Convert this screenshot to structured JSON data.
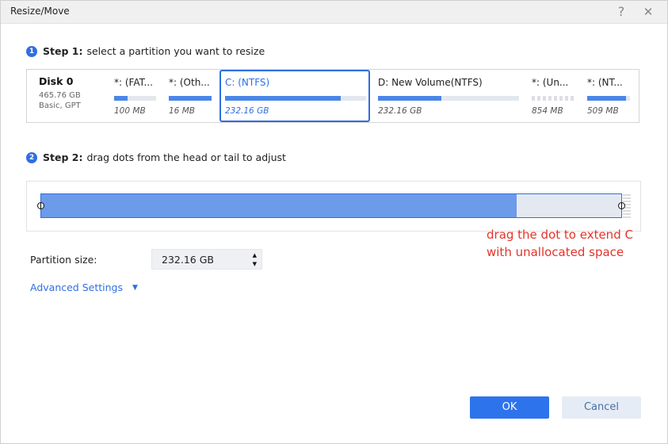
{
  "window": {
    "title": "Resize/Move",
    "help_glyph": "?",
    "close_glyph": "✕"
  },
  "step1": {
    "num": "1",
    "bold": "Step 1:",
    "text": "select a partition you want to resize"
  },
  "step2": {
    "num": "2",
    "bold": "Step 2:",
    "text": "drag dots from the head or tail to adjust"
  },
  "disk": {
    "name": "Disk 0",
    "size": "465.76 GB",
    "type": "Basic, GPT"
  },
  "partitions": [
    {
      "name": "*: (FAT...",
      "size": "100 MB",
      "used": 0.32
    },
    {
      "name": "*: (Oth...",
      "size": "16 MB",
      "used": 1.0
    },
    {
      "name": "C: (NTFS)",
      "size": "232.16 GB",
      "used": 0.82
    },
    {
      "name": "D: New Volume(NTFS)",
      "size": "232.16 GB",
      "used": 0.45
    },
    {
      "name": "*: (Un...",
      "size": "854 MB",
      "used": 0
    },
    {
      "name": "*: (NT...",
      "size": "509 MB",
      "used": 0.9
    }
  ],
  "resize": {
    "used_fraction": 0.82
  },
  "annotation": {
    "line1": "drag the dot to extend C",
    "line2": "with unallocated space"
  },
  "partition_size": {
    "label": "Partition size:",
    "value": "232.16 GB"
  },
  "advanced": {
    "label": "Advanced Settings",
    "arrow": "▼"
  },
  "buttons": {
    "ok": "OK",
    "cancel": "Cancel"
  },
  "colors": {
    "accent": "#2f6fe0",
    "bar_fill": "#4a86e8",
    "annotation": "#e5332a"
  }
}
